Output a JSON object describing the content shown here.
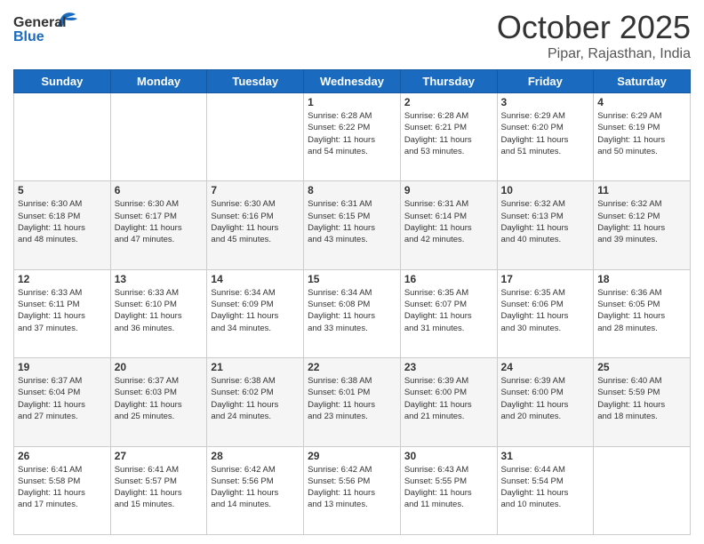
{
  "header": {
    "logo_line1": "General",
    "logo_line2": "Blue",
    "month_title": "October 2025",
    "subtitle": "Pipar, Rajasthan, India"
  },
  "weekdays": [
    "Sunday",
    "Monday",
    "Tuesday",
    "Wednesday",
    "Thursday",
    "Friday",
    "Saturday"
  ],
  "weeks": [
    [
      {
        "day": "",
        "info": ""
      },
      {
        "day": "",
        "info": ""
      },
      {
        "day": "",
        "info": ""
      },
      {
        "day": "1",
        "info": "Sunrise: 6:28 AM\nSunset: 6:22 PM\nDaylight: 11 hours\nand 54 minutes."
      },
      {
        "day": "2",
        "info": "Sunrise: 6:28 AM\nSunset: 6:21 PM\nDaylight: 11 hours\nand 53 minutes."
      },
      {
        "day": "3",
        "info": "Sunrise: 6:29 AM\nSunset: 6:20 PM\nDaylight: 11 hours\nand 51 minutes."
      },
      {
        "day": "4",
        "info": "Sunrise: 6:29 AM\nSunset: 6:19 PM\nDaylight: 11 hours\nand 50 minutes."
      }
    ],
    [
      {
        "day": "5",
        "info": "Sunrise: 6:30 AM\nSunset: 6:18 PM\nDaylight: 11 hours\nand 48 minutes."
      },
      {
        "day": "6",
        "info": "Sunrise: 6:30 AM\nSunset: 6:17 PM\nDaylight: 11 hours\nand 47 minutes."
      },
      {
        "day": "7",
        "info": "Sunrise: 6:30 AM\nSunset: 6:16 PM\nDaylight: 11 hours\nand 45 minutes."
      },
      {
        "day": "8",
        "info": "Sunrise: 6:31 AM\nSunset: 6:15 PM\nDaylight: 11 hours\nand 43 minutes."
      },
      {
        "day": "9",
        "info": "Sunrise: 6:31 AM\nSunset: 6:14 PM\nDaylight: 11 hours\nand 42 minutes."
      },
      {
        "day": "10",
        "info": "Sunrise: 6:32 AM\nSunset: 6:13 PM\nDaylight: 11 hours\nand 40 minutes."
      },
      {
        "day": "11",
        "info": "Sunrise: 6:32 AM\nSunset: 6:12 PM\nDaylight: 11 hours\nand 39 minutes."
      }
    ],
    [
      {
        "day": "12",
        "info": "Sunrise: 6:33 AM\nSunset: 6:11 PM\nDaylight: 11 hours\nand 37 minutes."
      },
      {
        "day": "13",
        "info": "Sunrise: 6:33 AM\nSunset: 6:10 PM\nDaylight: 11 hours\nand 36 minutes."
      },
      {
        "day": "14",
        "info": "Sunrise: 6:34 AM\nSunset: 6:09 PM\nDaylight: 11 hours\nand 34 minutes."
      },
      {
        "day": "15",
        "info": "Sunrise: 6:34 AM\nSunset: 6:08 PM\nDaylight: 11 hours\nand 33 minutes."
      },
      {
        "day": "16",
        "info": "Sunrise: 6:35 AM\nSunset: 6:07 PM\nDaylight: 11 hours\nand 31 minutes."
      },
      {
        "day": "17",
        "info": "Sunrise: 6:35 AM\nSunset: 6:06 PM\nDaylight: 11 hours\nand 30 minutes."
      },
      {
        "day": "18",
        "info": "Sunrise: 6:36 AM\nSunset: 6:05 PM\nDaylight: 11 hours\nand 28 minutes."
      }
    ],
    [
      {
        "day": "19",
        "info": "Sunrise: 6:37 AM\nSunset: 6:04 PM\nDaylight: 11 hours\nand 27 minutes."
      },
      {
        "day": "20",
        "info": "Sunrise: 6:37 AM\nSunset: 6:03 PM\nDaylight: 11 hours\nand 25 minutes."
      },
      {
        "day": "21",
        "info": "Sunrise: 6:38 AM\nSunset: 6:02 PM\nDaylight: 11 hours\nand 24 minutes."
      },
      {
        "day": "22",
        "info": "Sunrise: 6:38 AM\nSunset: 6:01 PM\nDaylight: 11 hours\nand 23 minutes."
      },
      {
        "day": "23",
        "info": "Sunrise: 6:39 AM\nSunset: 6:00 PM\nDaylight: 11 hours\nand 21 minutes."
      },
      {
        "day": "24",
        "info": "Sunrise: 6:39 AM\nSunset: 6:00 PM\nDaylight: 11 hours\nand 20 minutes."
      },
      {
        "day": "25",
        "info": "Sunrise: 6:40 AM\nSunset: 5:59 PM\nDaylight: 11 hours\nand 18 minutes."
      }
    ],
    [
      {
        "day": "26",
        "info": "Sunrise: 6:41 AM\nSunset: 5:58 PM\nDaylight: 11 hours\nand 17 minutes."
      },
      {
        "day": "27",
        "info": "Sunrise: 6:41 AM\nSunset: 5:57 PM\nDaylight: 11 hours\nand 15 minutes."
      },
      {
        "day": "28",
        "info": "Sunrise: 6:42 AM\nSunset: 5:56 PM\nDaylight: 11 hours\nand 14 minutes."
      },
      {
        "day": "29",
        "info": "Sunrise: 6:42 AM\nSunset: 5:56 PM\nDaylight: 11 hours\nand 13 minutes."
      },
      {
        "day": "30",
        "info": "Sunrise: 6:43 AM\nSunset: 5:55 PM\nDaylight: 11 hours\nand 11 minutes."
      },
      {
        "day": "31",
        "info": "Sunrise: 6:44 AM\nSunset: 5:54 PM\nDaylight: 11 hours\nand 10 minutes."
      },
      {
        "day": "",
        "info": ""
      }
    ]
  ]
}
